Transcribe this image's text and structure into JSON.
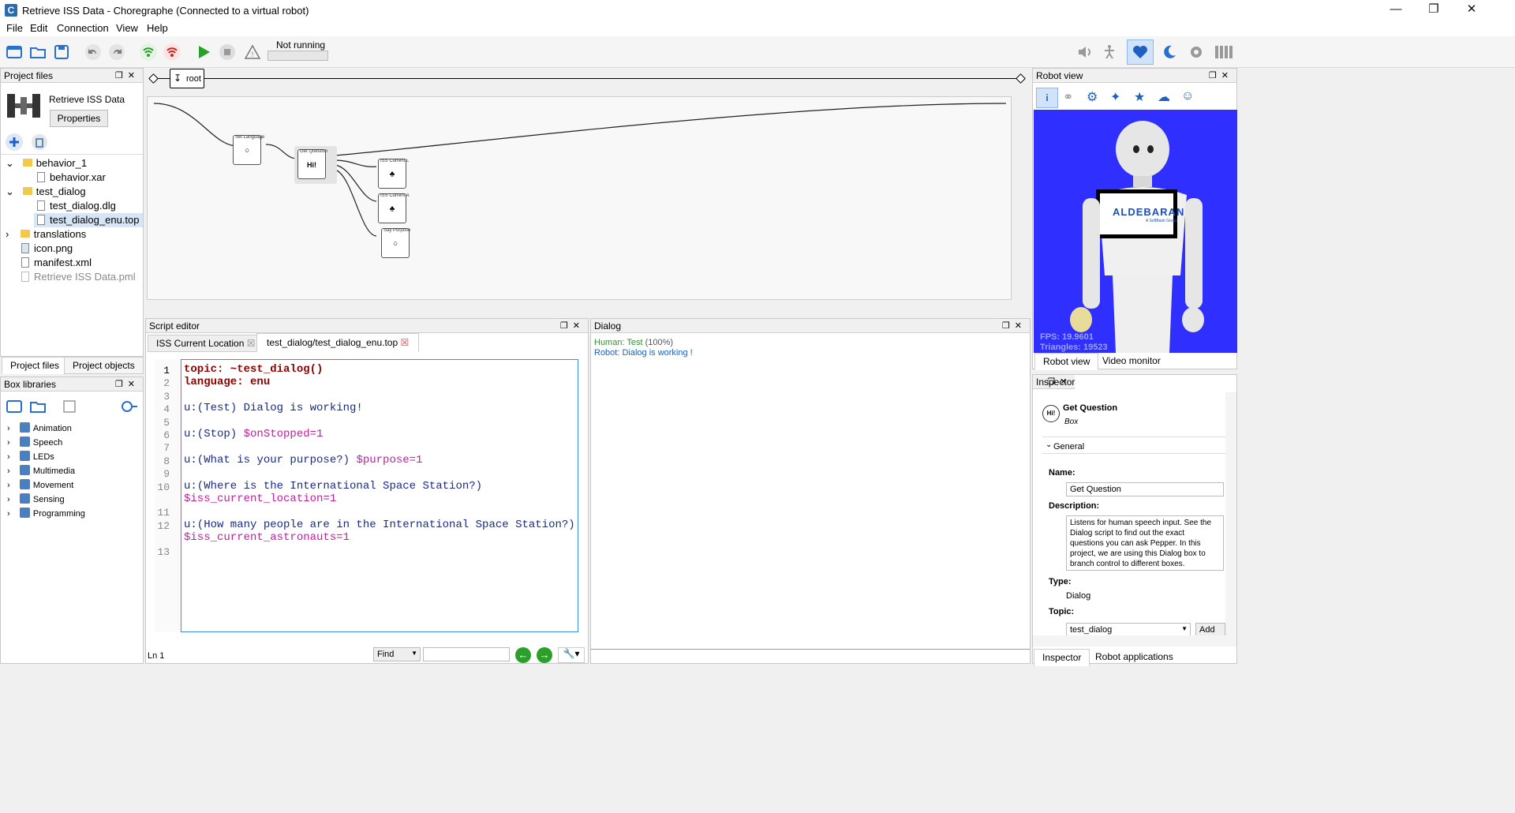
{
  "window": {
    "title": "Retrieve ISS Data - Choregraphe (Connected to a virtual robot)",
    "app_icon": "C"
  },
  "menu": [
    "File",
    "Edit",
    "Connection",
    "View",
    "Help"
  ],
  "toolbar": {
    "status": "Not running"
  },
  "project_files": {
    "title": "Project files",
    "project_name": "Retrieve ISS Data",
    "properties_label": "Properties",
    "tree": [
      {
        "label": "behavior_1",
        "type": "folder",
        "expanded": true
      },
      {
        "label": "behavior.xar",
        "type": "file"
      },
      {
        "label": "test_dialog",
        "type": "folder",
        "expanded": true
      },
      {
        "label": "test_dialog.dlg",
        "type": "file"
      },
      {
        "label": "test_dialog_enu.top",
        "type": "file",
        "selected": true
      },
      {
        "label": "translations",
        "type": "folder",
        "expanded": false
      },
      {
        "label": "icon.png",
        "type": "file"
      },
      {
        "label": "manifest.xml",
        "type": "file"
      },
      {
        "label": "Retrieve ISS Data.pml",
        "type": "file",
        "dimmed": true
      }
    ],
    "tabs": [
      "Project files",
      "Project objects"
    ]
  },
  "box_libraries": {
    "title": "Box libraries",
    "items": [
      "Animation",
      "Speech",
      "LEDs",
      "Multimedia",
      "Movement",
      "Sensing",
      "Programming"
    ]
  },
  "flow": {
    "root_label": "root",
    "boxes": [
      "Set Language",
      "Get Question",
      "ISS Current L",
      "ISS Current A",
      "Say Purpose"
    ],
    "get_question_icon": "Hi!"
  },
  "script_editor": {
    "title": "Script editor",
    "tabs": [
      "ISS Current Location",
      "test_dialog/test_dialog_enu.top"
    ],
    "line_numbers": [
      "1",
      "2",
      "3",
      "4",
      "5",
      "6",
      "7",
      "8",
      "9",
      "10",
      "",
      "11",
      "12",
      "",
      "13"
    ],
    "lines": [
      {
        "a": "topic: ~test_dialog()",
        "b": ""
      },
      {
        "a": "language: enu",
        "b": ""
      },
      {
        "a": "",
        "b": ""
      },
      {
        "a": "u:(Test) Dialog is working!",
        "b": ""
      },
      {
        "a": "",
        "b": ""
      },
      {
        "a": "u:(Stop) ",
        "b": "$onStopped=1"
      },
      {
        "a": "",
        "b": ""
      },
      {
        "a": "u:(What is your purpose?) ",
        "b": "$purpose=1"
      },
      {
        "a": "",
        "b": ""
      },
      {
        "a": "u:(Where is the International Space Station?)",
        "b": ""
      },
      {
        "a": "",
        "b": "$iss_current_location=1"
      },
      {
        "a": "",
        "b": ""
      },
      {
        "a": "u:(How many people are in the International Space Station?)",
        "b": ""
      },
      {
        "a": "",
        "b": "$iss_current_astronauts=1"
      },
      {
        "a": "",
        "b": ""
      }
    ],
    "status": "Ln 1",
    "find_label": "Find"
  },
  "dialog": {
    "title": "Dialog",
    "human": "Human: Test",
    "human_conf": "(100%)",
    "robot": "Robot: Dialog is working  !"
  },
  "robot_view": {
    "title": "Robot view",
    "fps": "FPS: 19.9601",
    "triangles": "Triangles: 19523",
    "brand": "ALDEBARAN",
    "brand_sub": "A SoftBank Group",
    "tabs": [
      "Robot view",
      "Video monitor"
    ]
  },
  "inspector": {
    "title": "Inspector",
    "box_name": "Get Question",
    "box_type": "Box",
    "section": "General",
    "name_label": "Name:",
    "name_value": "Get Question",
    "desc_label": "Description:",
    "desc_value": "Listens for human speech input. See the Dialog script to find out the exact questions you can ask Pepper. In this project, we are using this Dialog box to branch control to different boxes.",
    "type_label": "Type:",
    "type_value": "Dialog",
    "topic_label": "Topic:",
    "topic_value": "test_dialog",
    "add_label": "Add",
    "tabs": [
      "Inspector",
      "Robot applications"
    ]
  }
}
